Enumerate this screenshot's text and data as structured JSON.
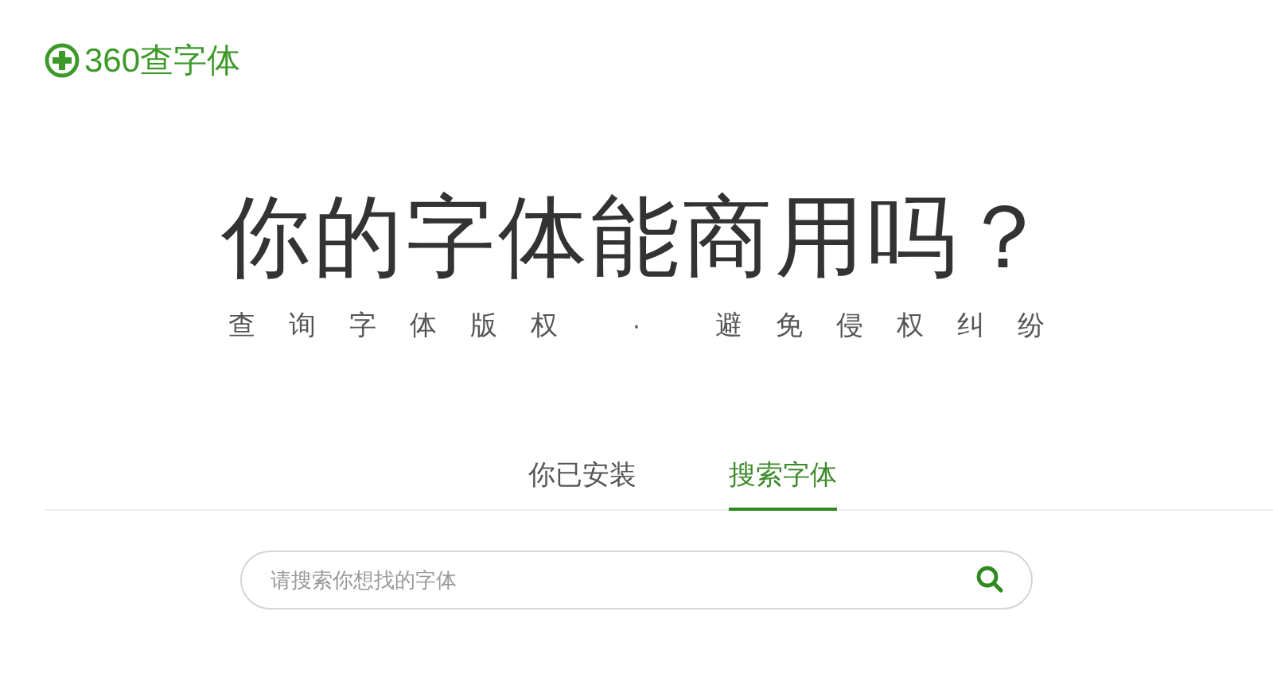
{
  "logo": {
    "text": "360查字体"
  },
  "headline": "你的字体能商用吗？",
  "tagline": "查询字体版权 · 避免侵权纠纷",
  "tabs": [
    {
      "label": "你已安装",
      "selected": false
    },
    {
      "label": "搜索字体",
      "selected": true
    }
  ],
  "search": {
    "placeholder": "请搜索你想找的字体"
  }
}
